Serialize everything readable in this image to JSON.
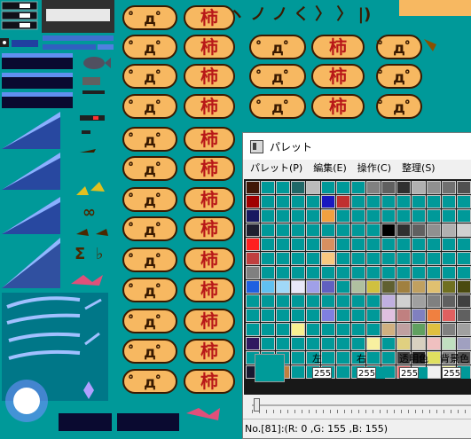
{
  "sprites": {
    "emote_label": "゜д゜",
    "kanji_label": "柿",
    "arrow_row": "ヽ ノ ノ く 〉 〉 |)",
    "infinity": "∞",
    "sigma": "Σ",
    "flat": "♭",
    "fish": "fish",
    "sheet_bg": "#009999",
    "face_fill": "#f7b861",
    "pink": "#e0507a"
  },
  "palette_window": {
    "title": "パレット",
    "menu": [
      "パレット(P)",
      "編集(E)",
      "操作(C)",
      "整理(S)"
    ],
    "labels": {
      "left": "左",
      "right": "右",
      "transparent": "透明色",
      "background": "背景色"
    },
    "values": {
      "left": "255",
      "right": "255",
      "transparent": "255",
      "background": "255"
    },
    "status": "No.[81]:(R: 0 ,G: 155 ,B: 155)",
    "grid_colors": [
      [
        "#401808",
        "#009999",
        "#009999",
        "#206868",
        "#bbbbbb",
        "#009999",
        "#009999",
        "#009999",
        "#808080",
        "#606060",
        "#303030",
        "#b0b0b0",
        "#909090",
        "#707070",
        "#505050",
        "#202020"
      ],
      [
        "#a00000",
        "#009999",
        "#009999",
        "#009999",
        "#009999",
        "#1818c0",
        "#c03030",
        "#009999",
        "#009999",
        "#009999",
        "#009999",
        "#009999",
        "#009999",
        "#009999",
        "#009999",
        "#009999"
      ],
      [
        "#181860",
        "#009999",
        "#009999",
        "#009999",
        "#009999",
        "#f0a040",
        "#009999",
        "#009999",
        "#009999",
        "#009999",
        "#009999",
        "#009999",
        "#009999",
        "#009999",
        "#009999",
        "#009999"
      ],
      [
        "#202030",
        "#009999",
        "#009999",
        "#009999",
        "#009999",
        "#009999",
        "#009999",
        "#009999",
        "#009999",
        "#000000",
        "#303030",
        "#606060",
        "#909090",
        "#b0b0b0",
        "#d0d0d0",
        "#ffffff"
      ],
      [
        "#ff2020",
        "#009999",
        "#009999",
        "#009999",
        "#009999",
        "#d89060",
        "#009999",
        "#009999",
        "#009999",
        "#009999",
        "#009999",
        "#009999",
        "#009999",
        "#009999",
        "#009999",
        "#009999"
      ],
      [
        "#c04040",
        "#009999",
        "#009999",
        "#009999",
        "#009999",
        "#f8c880",
        "#009999",
        "#009999",
        "#009999",
        "#009999",
        "#009999",
        "#009999",
        "#009999",
        "#009999",
        "#009999",
        "#009999"
      ],
      [
        "#808080",
        "#009999",
        "#009999",
        "#009999",
        "#009999",
        "#009999",
        "#009999",
        "#009999",
        "#009999",
        "#009999",
        "#009999",
        "#009999",
        "#009999",
        "#009999",
        "#009999",
        "#009999"
      ],
      [
        "#2060e0",
        "#60c0f0",
        "#a0d8f8",
        "#e8e8f8",
        "#a0a0e8",
        "#6060c0",
        "#009999",
        "#b0c0a0",
        "#d0c040",
        "#606030",
        "#a08040",
        "#c0a060",
        "#e0c070",
        "#707020",
        "#4a4a10",
        "#909050"
      ],
      [
        "#009999",
        "#009999",
        "#009999",
        "#009999",
        "#009999",
        "#009999",
        "#009999",
        "#009999",
        "#009999",
        "#c0b0e0",
        "#d0d0d0",
        "#a0a0a0",
        "#808080",
        "#606060",
        "#404040",
        "#202020"
      ],
      [
        "#009999",
        "#009999",
        "#009999",
        "#009999",
        "#009999",
        "#8080e0",
        "#009999",
        "#009999",
        "#009999",
        "#e0c0e0",
        "#c08080",
        "#8080c0",
        "#f08040",
        "#e06060",
        "#606060",
        "#c0c0c0"
      ],
      [
        "#009999",
        "#009999",
        "#009999",
        "#f8f090",
        "#009999",
        "#009999",
        "#009999",
        "#009999",
        "#009999",
        "#d0b080",
        "#c0a0a0",
        "#60a060",
        "#e0c040",
        "#808080",
        "#a0a0a0",
        "#303030"
      ],
      [
        "#301860",
        "#009999",
        "#009999",
        "#009999",
        "#009999",
        "#009999",
        "#009999",
        "#009999",
        "#f8f0a0",
        "#009999",
        "#e0d080",
        "#d8d0c0",
        "#f0c0c0",
        "#c0e0c0",
        "#a0a0c0",
        "#e0e0e0"
      ],
      [
        "#009999",
        "#009999",
        "#009999",
        "#009999",
        "#009999",
        "#009999",
        "#009999",
        "#009999",
        "#009999",
        "#009999",
        "#404040",
        "#202020",
        "#e0e060",
        "#808080",
        "#505050",
        "#101010"
      ],
      [
        "#181830",
        "#009999",
        "#c08040",
        "#009999",
        "#009999",
        "#009999",
        "#009999",
        "#009999",
        "#009999",
        "#009999",
        "#f07070",
        "#d0d0d0",
        "#f0f0f0",
        "#f8f8a0",
        "#009999",
        "#009999"
      ]
    ]
  }
}
